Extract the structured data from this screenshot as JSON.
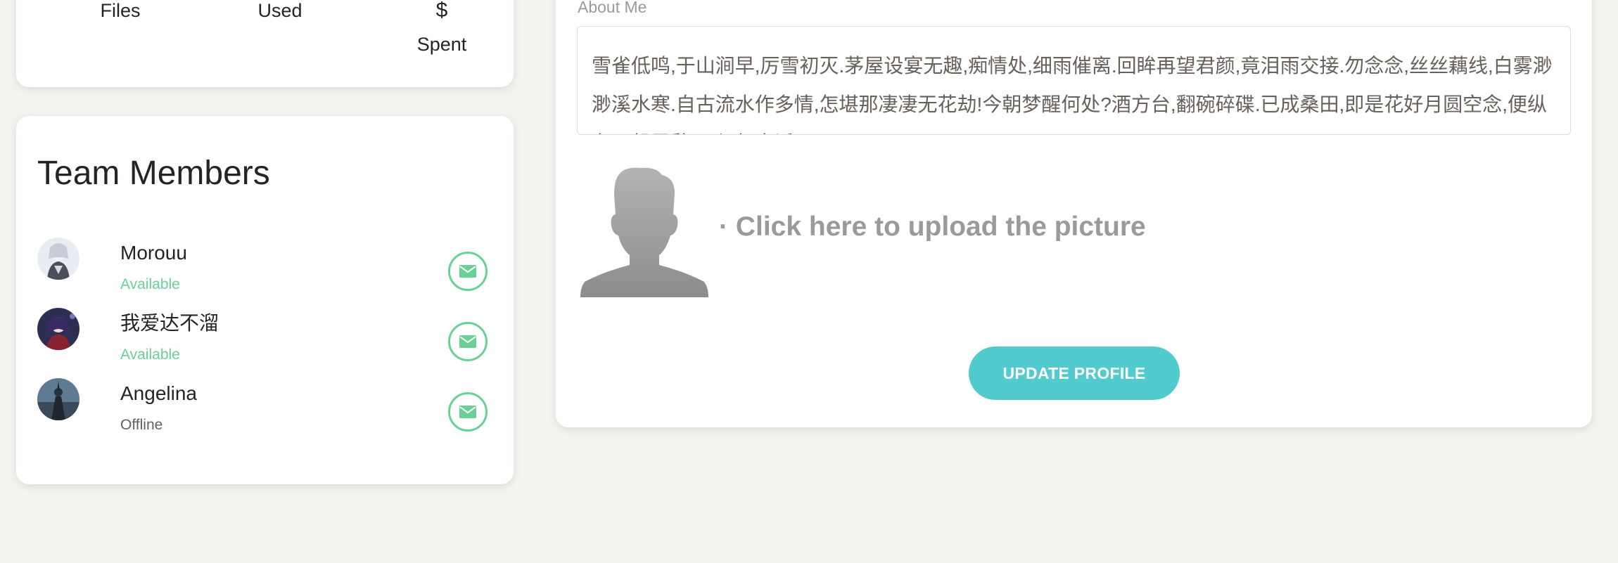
{
  "stats": {
    "files_label": "Files",
    "used_label": "Used",
    "spent_symbol": "$",
    "spent_label": "Spent"
  },
  "team": {
    "title": "Team Members",
    "members": [
      {
        "name": "Morouu",
        "status": "Available",
        "avatar_icon": "avatar-icon"
      },
      {
        "name": "我爱达不溜",
        "status": "Available",
        "avatar_icon": "avatar-icon"
      },
      {
        "name": "Angelina",
        "status": "Offline",
        "avatar_icon": "avatar-icon"
      }
    ]
  },
  "profile": {
    "about_label": "About Me",
    "about_text": "雪雀低鸣,于山涧早,厉雪初灭.茅屋设宴无趣,痴情处,细雨催离.回眸再望君颜,竟泪雨交接.勿念念,丝丝藕线,白雾渺渺溪水寒.自古流水作多情,怎堪那凄凄无花劫!今朝梦醒何处?酒方台,翻碗碎碟.已成桑田,即是花好月圆空念,便纵有万般思愁,更与何人诉?",
    "upload_text": "· Click here to upload the picture",
    "update_button": "UPDATE PROFILE"
  },
  "colors": {
    "success": "#6bd098",
    "primary": "#51cbce",
    "muted": "#9a9a9a",
    "background": "#f4f3ef"
  }
}
